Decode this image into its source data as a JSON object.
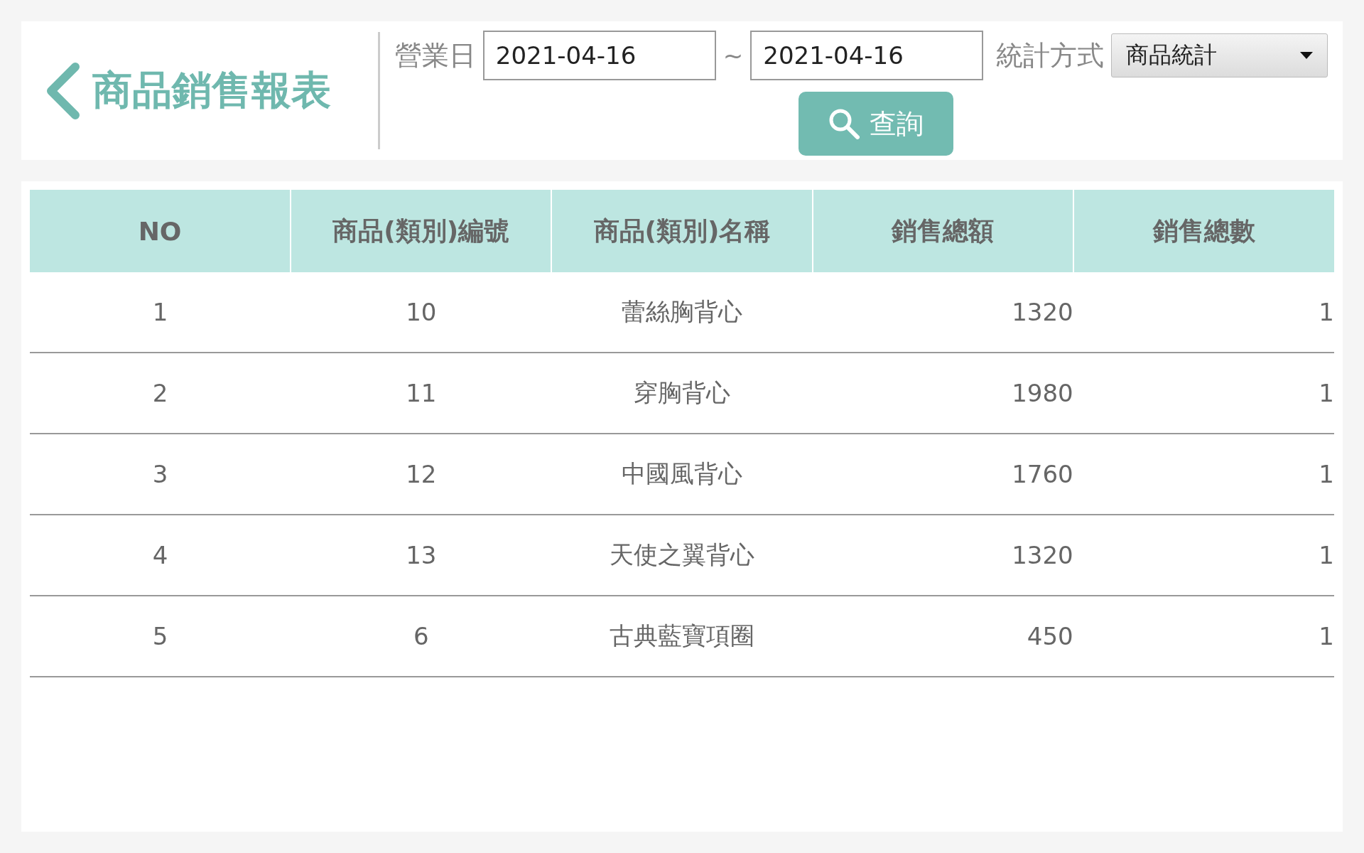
{
  "header": {
    "title": "商品銷售報表",
    "date_label": "營業日",
    "date_from": "2021-04-16",
    "separator": "~",
    "date_to": "2021-04-16",
    "mode_label": "統計方式",
    "mode_value": "商品統計",
    "search_button": "查詢"
  },
  "table": {
    "columns": [
      "NO",
      "商品(類別)編號",
      "商品(類別)名稱",
      "銷售總額",
      "銷售總數"
    ],
    "rows": [
      [
        "1",
        "10",
        "蕾絲胸背心",
        "1320",
        "1"
      ],
      [
        "2",
        "11",
        "穿胸背心",
        "1980",
        "1"
      ],
      [
        "3",
        "12",
        "中國風背心",
        "1760",
        "1"
      ],
      [
        "4",
        "13",
        "天使之翼背心",
        "1320",
        "1"
      ],
      [
        "5",
        "6",
        "古典藍寶項圈",
        "450",
        "1"
      ]
    ]
  }
}
